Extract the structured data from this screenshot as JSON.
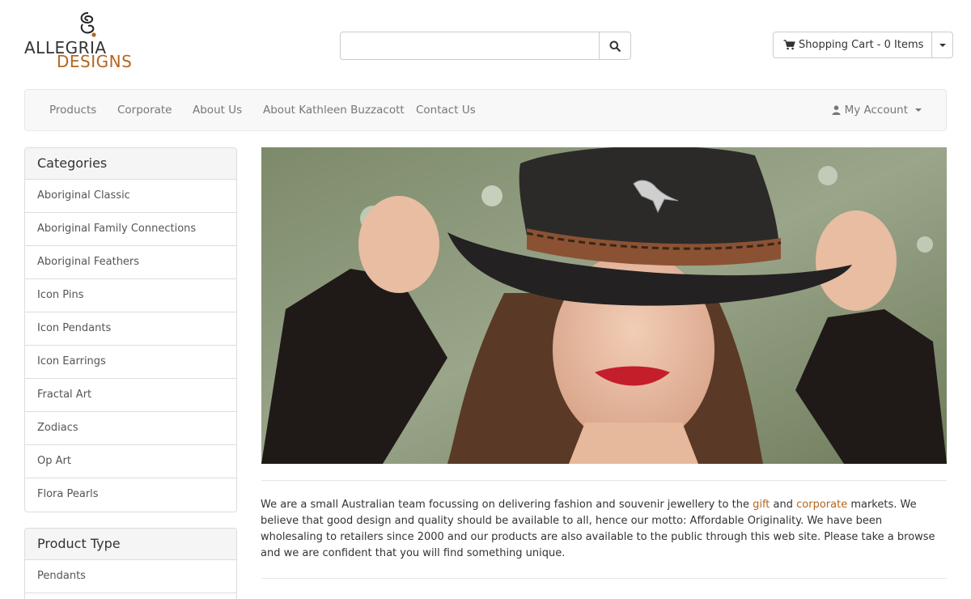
{
  "header": {
    "logo_line1": "ALLEGRIA",
    "logo_line2": "DESIGNS",
    "search": {
      "placeholder": "",
      "value": ""
    },
    "cart_label": "Shopping Cart - 0 Items"
  },
  "nav": {
    "items": [
      "Products",
      "Corporate",
      "About Us",
      "About Kathleen Buzzacott",
      "Contact Us"
    ],
    "account_label": "My Account"
  },
  "categories": {
    "title": "Categories",
    "items": [
      "Aboriginal Classic",
      "Aboriginal Family Connections",
      "Aboriginal Feathers",
      "Icon Pins",
      "Icon Pendants",
      "Icon Earrings",
      "Fractal Art",
      "Zodiacs",
      "Op Art",
      "Flora Pearls"
    ]
  },
  "product_type": {
    "title": "Product Type",
    "items": [
      "Pendants"
    ]
  },
  "about": {
    "text_1": "We are a small Australian team focussing on delivering fashion and souvenir jewellery to the ",
    "link_gift": "gift",
    "text_2": " and ",
    "link_corporate": "corporate",
    "text_3": " markets. We believe that good design and quality should be available to all, hence our motto: Affordable Originality. We have been wholesaling to retailers since 2000 and our products are also available to the public through this web site. Please take a browse and we are confident that you will find something unique."
  },
  "colors": {
    "accent": "#b5651d",
    "nav_bg": "#f8f8f8",
    "panel_head_bg": "#f5f5f5",
    "border": "#dddddd"
  },
  "icons": {
    "search": "search-icon",
    "cart": "shopping-cart-icon",
    "user": "user-icon",
    "caret": "caret-down-icon"
  }
}
